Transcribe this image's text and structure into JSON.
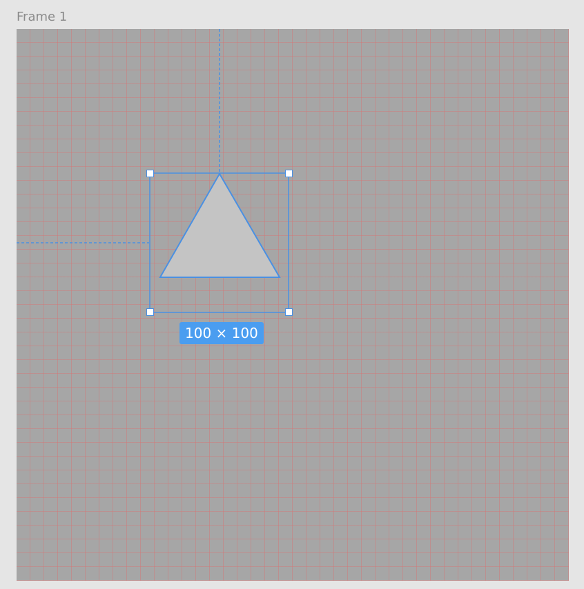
{
  "frame": {
    "label": "Frame 1"
  },
  "selection": {
    "size_label": "100 × 100",
    "shape": "triangle"
  },
  "colors": {
    "canvas_bg": "#e5e5e5",
    "frame_bg": "#a6a6a6",
    "grid_line": "#d67474",
    "selection_accent": "#4a9df0",
    "shape_fill": "#c4c4c4"
  }
}
